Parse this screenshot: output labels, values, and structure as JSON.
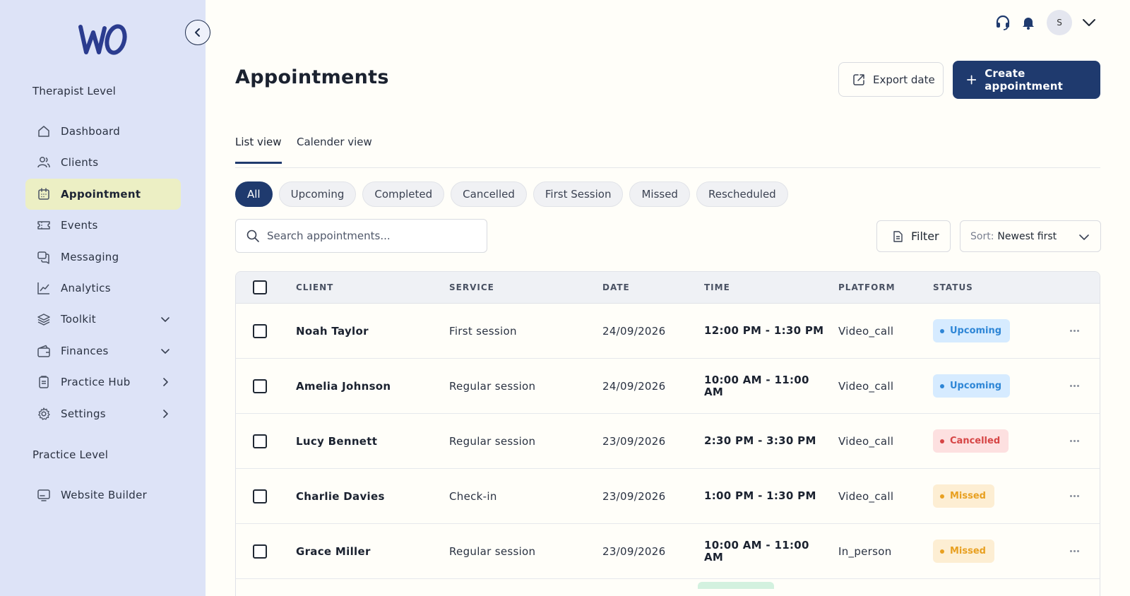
{
  "sidebar": {
    "therapist_level_label": "Therapist Level",
    "practice_level_label": "Practice Level",
    "items": [
      {
        "label": "Dashboard",
        "icon": "home-icon"
      },
      {
        "label": "Clients",
        "icon": "users-icon"
      },
      {
        "label": "Appointment",
        "icon": "calendar-icon",
        "active": true
      },
      {
        "label": "Events",
        "icon": "ticket-icon"
      },
      {
        "label": "Messaging",
        "icon": "chat-icon"
      },
      {
        "label": "Analytics",
        "icon": "chart-line-icon"
      },
      {
        "label": "Toolkit",
        "icon": "layers-icon",
        "chevron": "down"
      },
      {
        "label": "Finances",
        "icon": "wallet-icon",
        "chevron": "down"
      },
      {
        "label": "Practice Hub",
        "icon": "clipboard-icon",
        "chevron": "right"
      },
      {
        "label": "Settings",
        "icon": "gear-icon",
        "chevron": "right"
      }
    ],
    "practice_items": [
      {
        "label": "Website Builder",
        "icon": "monitor-icon"
      }
    ]
  },
  "header": {
    "avatar_initial": "S"
  },
  "page": {
    "title": "Appointments",
    "export_label": "Export date",
    "create_label": "Create appointment"
  },
  "tabs": [
    "List view",
    "Calender view"
  ],
  "filters": [
    "All",
    "Upcoming",
    "Completed",
    "Cancelled",
    "First Session",
    "Missed",
    "Rescheduled"
  ],
  "search": {
    "placeholder": "Search appointments..."
  },
  "filter_button": "Filter",
  "sort": {
    "key": "Sort:",
    "value": "Newest first"
  },
  "table": {
    "columns": [
      "CLIENT",
      "SERVICE",
      "DATE",
      "TIME",
      "PLATFORM",
      "STATUS"
    ],
    "rows": [
      {
        "client": "Noah Taylor",
        "service": "First session",
        "date": "24/09/2026",
        "time": "12:00 PM - 1:30 PM",
        "platform": "Video_call",
        "status": "Upcoming"
      },
      {
        "client": "Amelia Johnson",
        "service": "Regular session",
        "date": "24/09/2026",
        "time": "10:00 AM - 11:00 AM",
        "platform": "Video_call",
        "status": "Upcoming"
      },
      {
        "client": "Lucy Bennett",
        "service": "Regular session",
        "date": "23/09/2026",
        "time": "2:30 PM - 3:30 PM",
        "platform": "Video_call",
        "status": "Cancelled"
      },
      {
        "client": "Charlie Davies",
        "service": "Check-in",
        "date": "23/09/2026",
        "time": "1:00 PM - 1:30 PM",
        "platform": "Video_call",
        "status": "Missed"
      },
      {
        "client": "Grace Miller",
        "service": "Regular session",
        "date": "23/09/2026",
        "time": "10:00 AM - 11:00 AM",
        "platform": "In_person",
        "status": "Missed"
      }
    ]
  },
  "colors": {
    "sidebar_bg": "#dde3f7",
    "accent": "#1f3a6e",
    "active_nav": "#ecefc4",
    "upcoming": "#2e86d6",
    "cancelled": "#d64545",
    "missed": "#e8a021"
  }
}
